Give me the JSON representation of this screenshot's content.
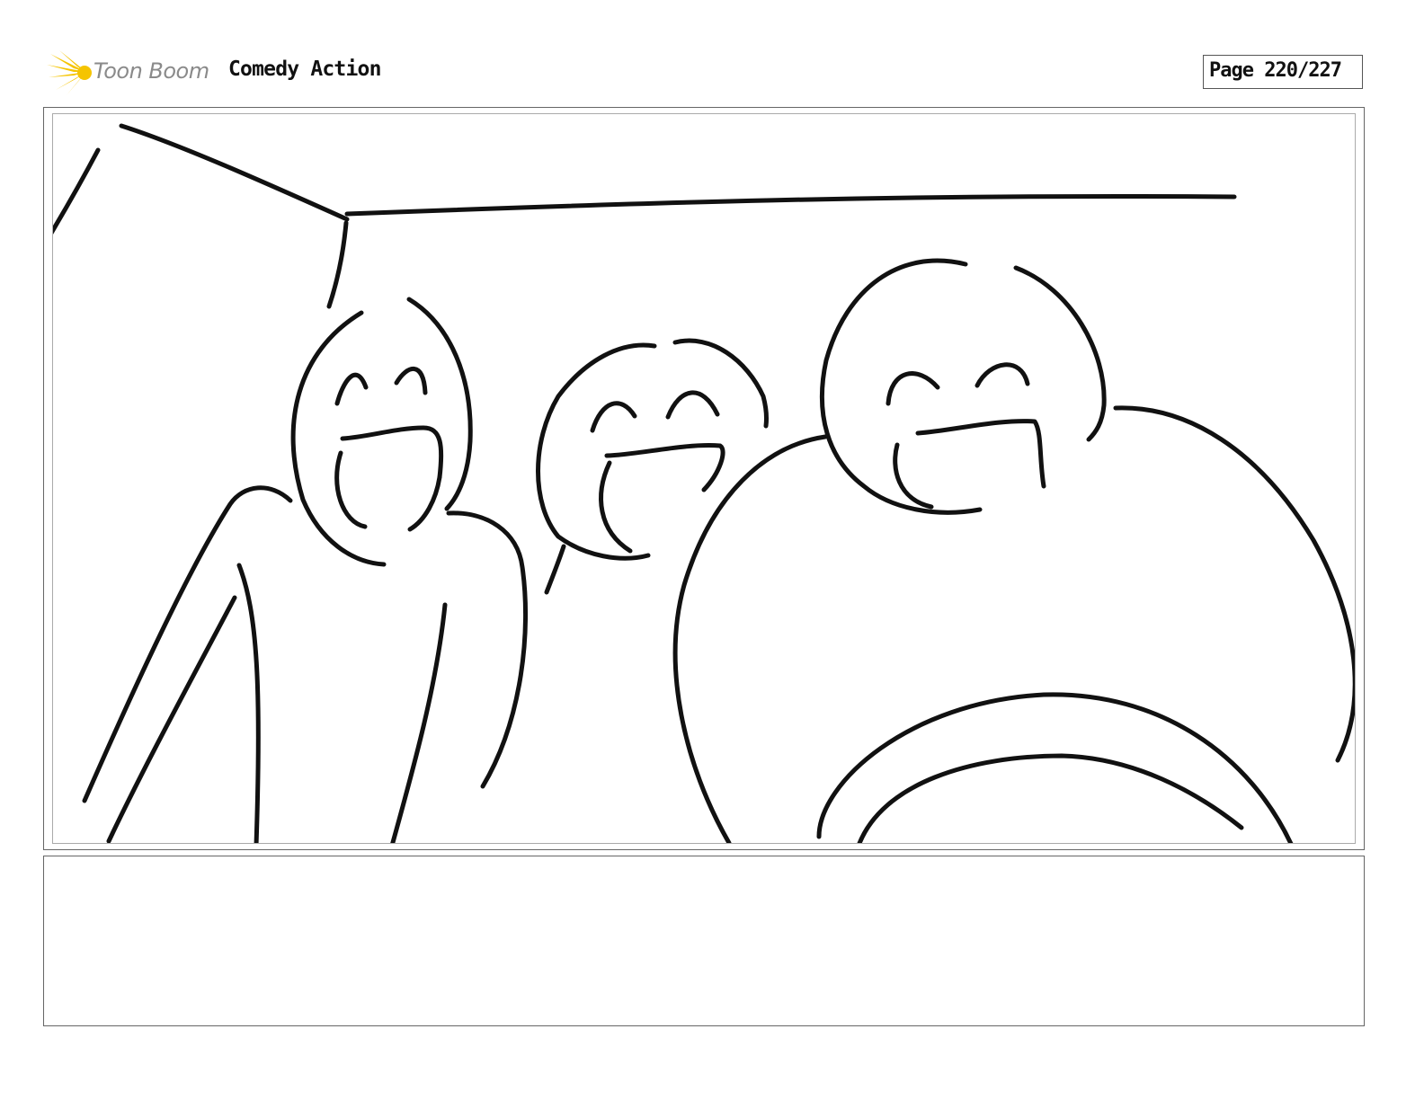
{
  "header": {
    "logo_text": "Toon Boom",
    "project_title": "Comedy Action",
    "page_label": "Page 220/227"
  },
  "panel": {
    "name": "storyboard-panel",
    "figures": [
      "left-character",
      "middle-character",
      "right-character"
    ]
  },
  "caption": {
    "text": ""
  },
  "colors": {
    "logo_yellow": "#f5c400",
    "logo_gray": "#8a8a8a",
    "ink": "#111111",
    "frame": "#666666"
  }
}
